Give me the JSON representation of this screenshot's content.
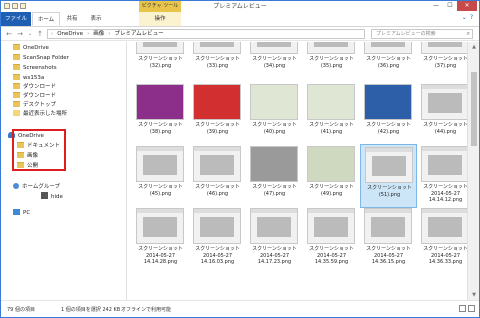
{
  "titlebar": {
    "title": "プレミアムレビュー",
    "context_tab_header": "ピクチャ ツール",
    "buttons": {
      "minimize": "—",
      "maximize": "☐",
      "close": "✕"
    }
  },
  "ribbon": {
    "tabs": [
      "ファイル",
      "ホーム",
      "共有",
      "表示",
      "操作"
    ],
    "help": "?"
  },
  "address": {
    "path": [
      "OneDrive",
      "画像",
      "プレミアムレビュー"
    ],
    "search_placeholder": "プレミアムレビューの検索"
  },
  "nav": {
    "items": [
      {
        "label": "OneDrive",
        "icon": "folder-icon"
      },
      {
        "label": "ScanSnap Folder",
        "icon": "folder-icon"
      },
      {
        "label": "Screenshots",
        "icon": "folder-icon"
      },
      {
        "label": "ws153a",
        "icon": "folder-icon"
      },
      {
        "label": "ダウンロード",
        "icon": "folder-icon"
      },
      {
        "label": "ダウンロード",
        "icon": "folder-icon"
      },
      {
        "label": "デスクトップ",
        "icon": "folder-icon"
      },
      {
        "label": "最近表示した場所",
        "icon": "recent-places-icon"
      },
      {
        "label": "OneDrive",
        "icon": "cloud-icon"
      },
      {
        "label": "ドキュメント",
        "icon": "folder-icon"
      },
      {
        "label": "画像",
        "icon": "folder-icon"
      },
      {
        "label": "公開",
        "icon": "folder-icon"
      },
      {
        "label": "ホームグループ",
        "icon": "homegroup-icon"
      },
      {
        "label": "hide",
        "icon": "user-avatar-icon"
      },
      {
        "label": "PC",
        "icon": "pc-icon"
      }
    ]
  },
  "files": [
    {
      "name": "スクリーンショット (32).png"
    },
    {
      "name": "スクリーンショット (33).png"
    },
    {
      "name": "スクリーンショット (34).png"
    },
    {
      "name": "スクリーンショット (35).png"
    },
    {
      "name": "スクリーンショット (36).png"
    },
    {
      "name": "スクリーンショット (37).png"
    },
    {
      "name": "スクリーンショット (38).png"
    },
    {
      "name": "スクリーンショット (39).png"
    },
    {
      "name": "スクリーンショット (40).png"
    },
    {
      "name": "スクリーンショット (41).png"
    },
    {
      "name": "スクリーンショット (42).png"
    },
    {
      "name": "スクリーンショット (44).png"
    },
    {
      "name": "スクリーンショット (45).png"
    },
    {
      "name": "スクリーンショット (46).png"
    },
    {
      "name": "スクリーンショット (47).png"
    },
    {
      "name": "スクリーンショット (49).png"
    },
    {
      "name": "スクリーンショット (51).png"
    },
    {
      "name": "スクリーンショット 2014-05-27 14.14.12.png"
    },
    {
      "name": "スクリーンショット 2014-05-27 14.14.28.png"
    },
    {
      "name": "スクリーンショット 2014-05-27 14.16.03.png"
    },
    {
      "name": "スクリーンショット 2014-05-27 14.17.23.png"
    },
    {
      "name": "スクリーンショット 2014-05-27 14.35.59.png"
    },
    {
      "name": "スクリーンショット 2014-05-27 14.36.15.png"
    },
    {
      "name": "スクリーンショット 2014-05-27 14.36.33.png"
    }
  ],
  "status": {
    "count": "79 個の項目",
    "selected": "1 個の項目を選択 242 KB",
    "availability": "オフラインで利用可能"
  }
}
